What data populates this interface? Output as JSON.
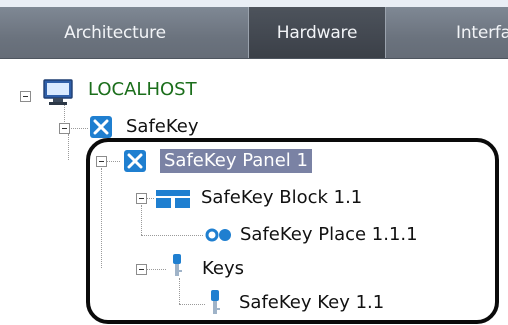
{
  "tabs": [
    {
      "label": "Architecture",
      "active": false
    },
    {
      "label": "Hardware",
      "active": true
    },
    {
      "label": "Interfa",
      "active": false
    }
  ],
  "tree": {
    "localhost": "LOCALHOST",
    "safekey": "SafeKey",
    "panel": "SafeKey Panel 1",
    "block": "SafeKey Block 1.1",
    "place": "SafeKey Place 1.1.1",
    "keys": "Keys",
    "key": "SafeKey Key 1.1"
  },
  "icons": {
    "computer": "computer-icon",
    "safekey": "safekey-icon",
    "panel": "safekey-panel-icon",
    "block": "block-icon",
    "place": "place-icon",
    "keys": "key-icon",
    "key": "key-icon"
  },
  "colors": {
    "selection": "#7a82a4",
    "host_text": "#1b6e1b",
    "active_tab": "#3b4048"
  }
}
